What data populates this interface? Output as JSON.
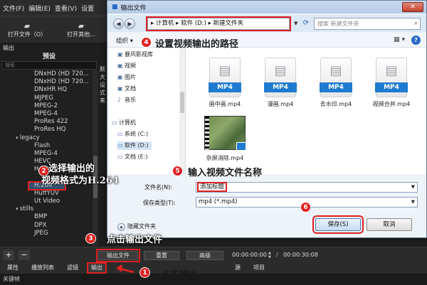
{
  "app": {
    "menu": [
      "文件(F)",
      "编辑(E)",
      "查看(V)",
      "设置"
    ],
    "toolbar": {
      "open_file": "打开文件（O）",
      "open_other": "打开其他..."
    },
    "panel_title": "输出",
    "presets_label": "预设",
    "search_placeholder": "搜索",
    "side_fragment": "默\n大\n设\n式\n来",
    "preset_items": [
      {
        "label": "DNxHD (HD 720...",
        "kind": "item"
      },
      {
        "label": "DNxHD (HD 720...",
        "kind": "item"
      },
      {
        "label": "DNxHR HQ",
        "kind": "item"
      },
      {
        "label": "MJPEG",
        "kind": "item"
      },
      {
        "label": "MPEG-2",
        "kind": "item"
      },
      {
        "label": "MPEG-4",
        "kind": "item"
      },
      {
        "label": "ProRes 422",
        "kind": "item"
      },
      {
        "label": "ProRes HQ",
        "kind": "item"
      },
      {
        "label": "legacy",
        "kind": "group"
      },
      {
        "label": "Flash",
        "kind": "item"
      },
      {
        "label": "MPEG-4",
        "kind": "item"
      },
      {
        "label": "HEVC",
        "kind": "item"
      },
      {
        "label": "H.264 CRF",
        "kind": "item"
      },
      {
        "label": "",
        "kind": "item"
      },
      {
        "label": "H.264",
        "kind": "selected"
      },
      {
        "label": "HuffYUV",
        "kind": "item"
      },
      {
        "label": "Ut Video",
        "kind": "item"
      },
      {
        "label": "stills",
        "kind": "group"
      },
      {
        "label": "BMP",
        "kind": "item"
      },
      {
        "label": "DPX",
        "kind": "item"
      },
      {
        "label": "JPEG",
        "kind": "item"
      }
    ],
    "bottom": {
      "add": "+",
      "remove": "−",
      "export_file": "输出文件",
      "reset": "重置",
      "advanced": "高级",
      "timecode_in": "00:00:00:00",
      "timecode_out": "00:00:30:08",
      "divider": "/"
    },
    "tabs": [
      "属性",
      "播放列表",
      "滤镜",
      "输出",
      "源",
      "项目"
    ],
    "status": "关键帧"
  },
  "dialog": {
    "title": "输出文件",
    "close": "✕",
    "address": "▸ 计算机 ▸ 软件 (D:) ▸ 新建文件夹",
    "search_placeholder": "搜索 新建文件夹",
    "organize": "组织 ▾",
    "nav_items": [
      {
        "label": "暴风影视库",
        "icon": "▣"
      },
      {
        "label": "视频",
        "icon": "▣"
      },
      {
        "label": "图片",
        "icon": "▣"
      },
      {
        "label": "文档",
        "icon": "▣"
      },
      {
        "label": "音乐",
        "icon": "♪"
      },
      {
        "label": "计算机",
        "icon": "▭"
      },
      {
        "label": "系统 (C:)",
        "icon": "▭"
      },
      {
        "label": "软件 (D:)",
        "icon": "▭"
      },
      {
        "label": "文档 (E:)",
        "icon": "▭"
      }
    ],
    "files": [
      {
        "name": "画中画.mp4",
        "badge": "MP4"
      },
      {
        "name": "漫画.mp4",
        "badge": "MP4"
      },
      {
        "name": "去水印.mp4",
        "badge": "MP4"
      },
      {
        "name": "视频合并.mp4",
        "badge": "MP4"
      },
      {
        "name": "杂屏消除.mp4",
        "badge": ""
      }
    ],
    "filename_label": "文件名(N):",
    "filename_value": "添加标题",
    "filetype_label": "保存类型(T):",
    "filetype_value": "mp4 (*.mp4)",
    "hide_folders": "隐藏文件夹",
    "save": "保存(S)",
    "cancel": "取消"
  },
  "annotations": {
    "steps": [
      "1",
      "2",
      "3",
      "4",
      "5",
      "6"
    ],
    "note1": "点击输出",
    "note2_line1": "选择输出的",
    "note2_line2": "视频格式为H.264",
    "note3": "点击输出文件",
    "note4": "设置视频输出的路径",
    "note5": "输入视频文件名称",
    "color": "#e02020"
  }
}
